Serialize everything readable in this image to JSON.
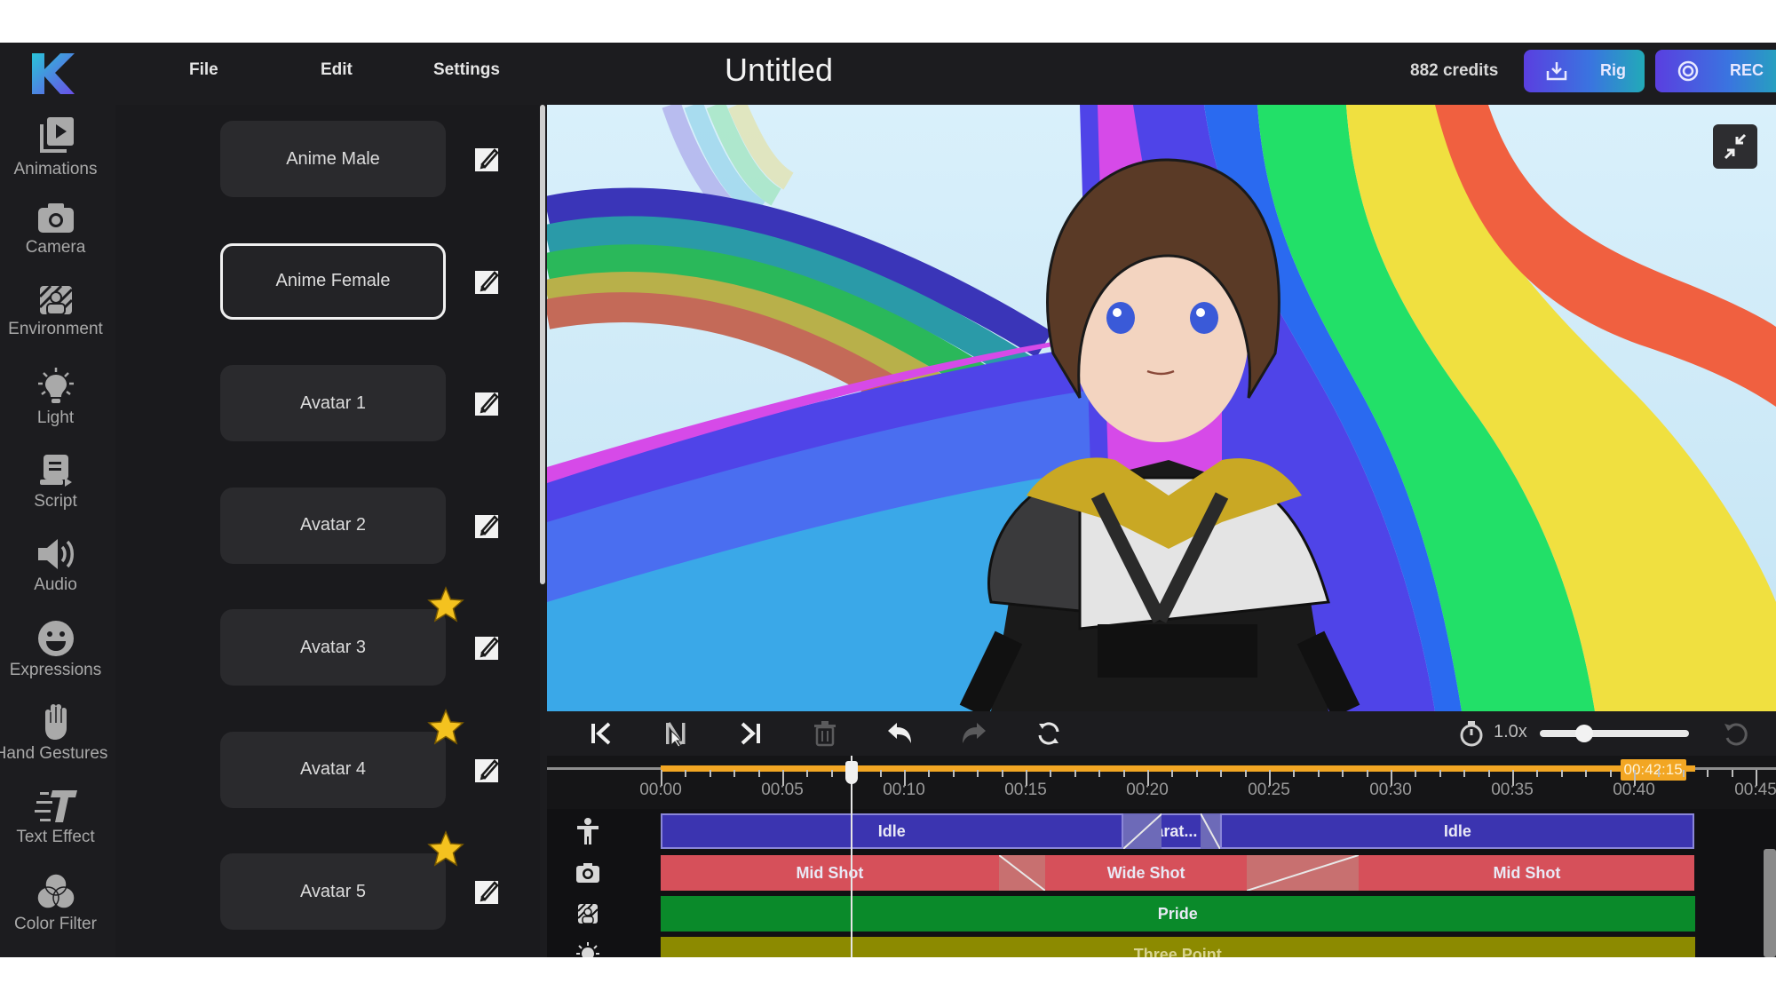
{
  "app": {
    "title": "Untitled",
    "menu": [
      "File",
      "Edit",
      "Settings"
    ],
    "credits": "882 credits",
    "buttons": {
      "rig": "Rig",
      "rec": "REC"
    },
    "brand_colors": {
      "accent_start": "#5a3fe0",
      "accent_end": "#22aab8",
      "timeline_accent": "#f2a623"
    }
  },
  "sidebar": {
    "items": [
      {
        "label": "Animations",
        "icon": "animations-icon"
      },
      {
        "label": "Camera",
        "icon": "camera-icon"
      },
      {
        "label": "Environment",
        "icon": "environment-icon"
      },
      {
        "label": "Light",
        "icon": "light-bulb-icon"
      },
      {
        "label": "Script",
        "icon": "script-icon"
      },
      {
        "label": "Audio",
        "icon": "speaker-icon"
      },
      {
        "label": "Expressions",
        "icon": "smiley-icon"
      },
      {
        "label": "Hand Gestures",
        "icon": "hand-icon"
      },
      {
        "label": "Text Effect",
        "icon": "text-effect-icon"
      },
      {
        "label": "Color Filter",
        "icon": "color-filter-icon"
      }
    ]
  },
  "avatars": {
    "items": [
      {
        "label": "Anime Male",
        "selected": false,
        "premium": false
      },
      {
        "label": "Anime Female",
        "selected": true,
        "premium": false
      },
      {
        "label": "Avatar 1",
        "selected": false,
        "premium": false
      },
      {
        "label": "Avatar 2",
        "selected": false,
        "premium": false
      },
      {
        "label": "Avatar 3",
        "selected": false,
        "premium": true
      },
      {
        "label": "Avatar 4",
        "selected": false,
        "premium": true
      },
      {
        "label": "Avatar 5",
        "selected": false,
        "premium": true
      }
    ]
  },
  "playback": {
    "speed": "1.0x",
    "speed_fraction": 0.3
  },
  "timeline": {
    "tick_labels": [
      "00:00",
      "00:05",
      "00:10",
      "00:15",
      "00:20",
      "00:25",
      "00:30",
      "00:35",
      "00:40",
      "00:45"
    ],
    "end_time": "00:42:15",
    "end_seconds": 42.5,
    "playhead_seconds": 7.8,
    "tracks": [
      {
        "name": "animation",
        "icon": "person-icon",
        "color": "#3b34b0",
        "clips": [
          {
            "label": "Idle",
            "start": 0,
            "end": 19
          },
          {
            "label": "karat...",
            "start": 19,
            "end": 23
          },
          {
            "label": "Idle",
            "start": 23,
            "end": 42.5
          }
        ],
        "transitions": [
          {
            "start": 19,
            "end": 20.6,
            "dir": "up"
          },
          {
            "start": 22.2,
            "end": 23,
            "dir": "down"
          }
        ]
      },
      {
        "name": "camera",
        "icon": "camera-icon",
        "color": "#d6505a",
        "clips": [
          {
            "label": "Mid Shot",
            "start": 0,
            "end": 13.9
          },
          {
            "label": "Wide Shot",
            "start": 15.8,
            "end": 24.1
          },
          {
            "label": "Mid Shot",
            "start": 28.7,
            "end": 42.5
          }
        ],
        "transitions": [
          {
            "start": 13.9,
            "end": 15.8,
            "dir": "down"
          },
          {
            "start": 24.1,
            "end": 28.7,
            "dir": "up"
          }
        ]
      },
      {
        "name": "environment",
        "icon": "environment-icon",
        "color": "#0a8a2a",
        "clips": [
          {
            "label": "Pride",
            "start": 0,
            "end": 42.5
          }
        ],
        "transitions": []
      },
      {
        "name": "light",
        "icon": "light-bulb-icon",
        "color": "#8c8a00",
        "clips": [
          {
            "label": "Three Point",
            "start": 0,
            "end": 42.5
          }
        ],
        "transitions": []
      }
    ]
  }
}
